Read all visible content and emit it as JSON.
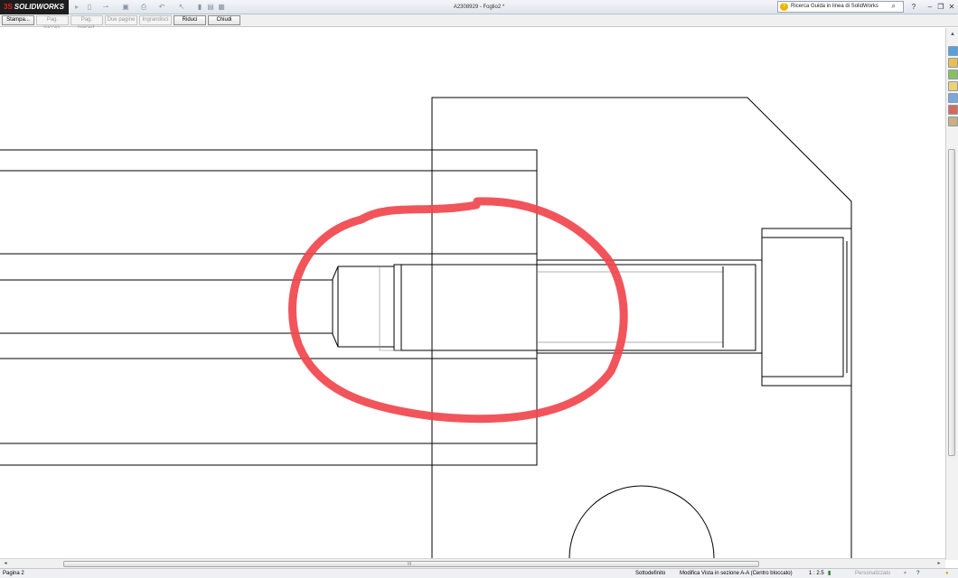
{
  "app": {
    "brand": "SOLIDWORKS",
    "document_title": "A2308929 - Foglio2 *"
  },
  "quick_access": {
    "icons": [
      "new-document-icon",
      "open-icon",
      "save-icon",
      "print-icon",
      "undo-icon",
      "select-icon",
      "rebuild-icon",
      "file-properties-icon",
      "options-icon"
    ]
  },
  "help": {
    "search_placeholder": "Ricerca Guida in linea di SolidWorks"
  },
  "window_controls": {
    "help": "?",
    "minimize": "–",
    "restore": "❐",
    "close": "✕"
  },
  "print_preview": {
    "buttons": [
      {
        "label": "Stampa...",
        "enabled": true
      },
      {
        "label": "Pag. succes.",
        "enabled": false
      },
      {
        "label": "Pag. preced.",
        "enabled": false
      },
      {
        "label": "Due pagine",
        "enabled": false
      },
      {
        "label": "Ingrandisci",
        "enabled": false
      },
      {
        "label": "Riduci",
        "enabled": true
      },
      {
        "label": "Chiudi",
        "enabled": true
      }
    ]
  },
  "task_pane": {
    "icons": [
      "solidworks-resources-icon",
      "design-library-icon",
      "file-explorer-icon",
      "search-icon",
      "view-palette-icon",
      "appearances-icon",
      "custom-properties-icon"
    ]
  },
  "hscroll": {
    "grip": "III"
  },
  "status": {
    "page": "Pagina 2",
    "definition": "Sottodefinito",
    "mode": "Modifica Vista in sezione A-A (Centro bloccato)",
    "scale": "1 : 2.5",
    "customize": "Personalizzato",
    "colors": {
      "annotation_circle": "#f0474d"
    }
  }
}
